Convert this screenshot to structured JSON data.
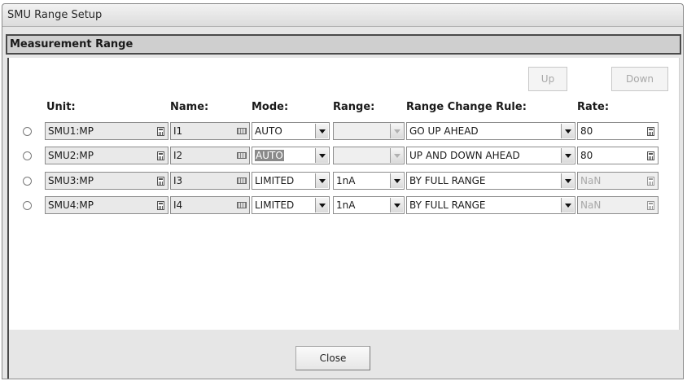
{
  "window": {
    "title": "SMU Range Setup"
  },
  "section": {
    "title": "Measurement Range"
  },
  "buttons": {
    "up": "Up",
    "down": "Down",
    "close": "Close"
  },
  "columns": {
    "unit": "Unit:",
    "name": "Name:",
    "mode": "Mode:",
    "range": "Range:",
    "rule": "Range Change Rule:",
    "rate": "Rate:"
  },
  "rows": [
    {
      "unit": "SMU1:MP",
      "name": "I1",
      "mode": "AUTO",
      "mode_highlighted": false,
      "range": "",
      "range_enabled": false,
      "rule": "GO UP AHEAD",
      "rate": "80",
      "rate_enabled": true
    },
    {
      "unit": "SMU2:MP",
      "name": "I2",
      "mode": "AUTO",
      "mode_highlighted": true,
      "range": "",
      "range_enabled": false,
      "rule": "UP AND DOWN AHEAD",
      "rate": "80",
      "rate_enabled": true
    },
    {
      "unit": "SMU3:MP",
      "name": "I3",
      "mode": "LIMITED",
      "mode_highlighted": false,
      "range": "1nA",
      "range_enabled": true,
      "rule": "BY FULL RANGE",
      "rate": "NaN",
      "rate_enabled": false
    },
    {
      "unit": "SMU4:MP",
      "name": "I4",
      "mode": "LIMITED",
      "mode_highlighted": false,
      "range": "1nA",
      "range_enabled": true,
      "rule": "BY FULL RANGE",
      "rate": "NaN",
      "rate_enabled": false
    }
  ],
  "icons": {
    "unit_button": "calculator-icon",
    "name_button": "keyboard-icon",
    "dropdown": "chevron-down-icon",
    "rate_button": "calculator-icon",
    "radio": "radio-button"
  }
}
